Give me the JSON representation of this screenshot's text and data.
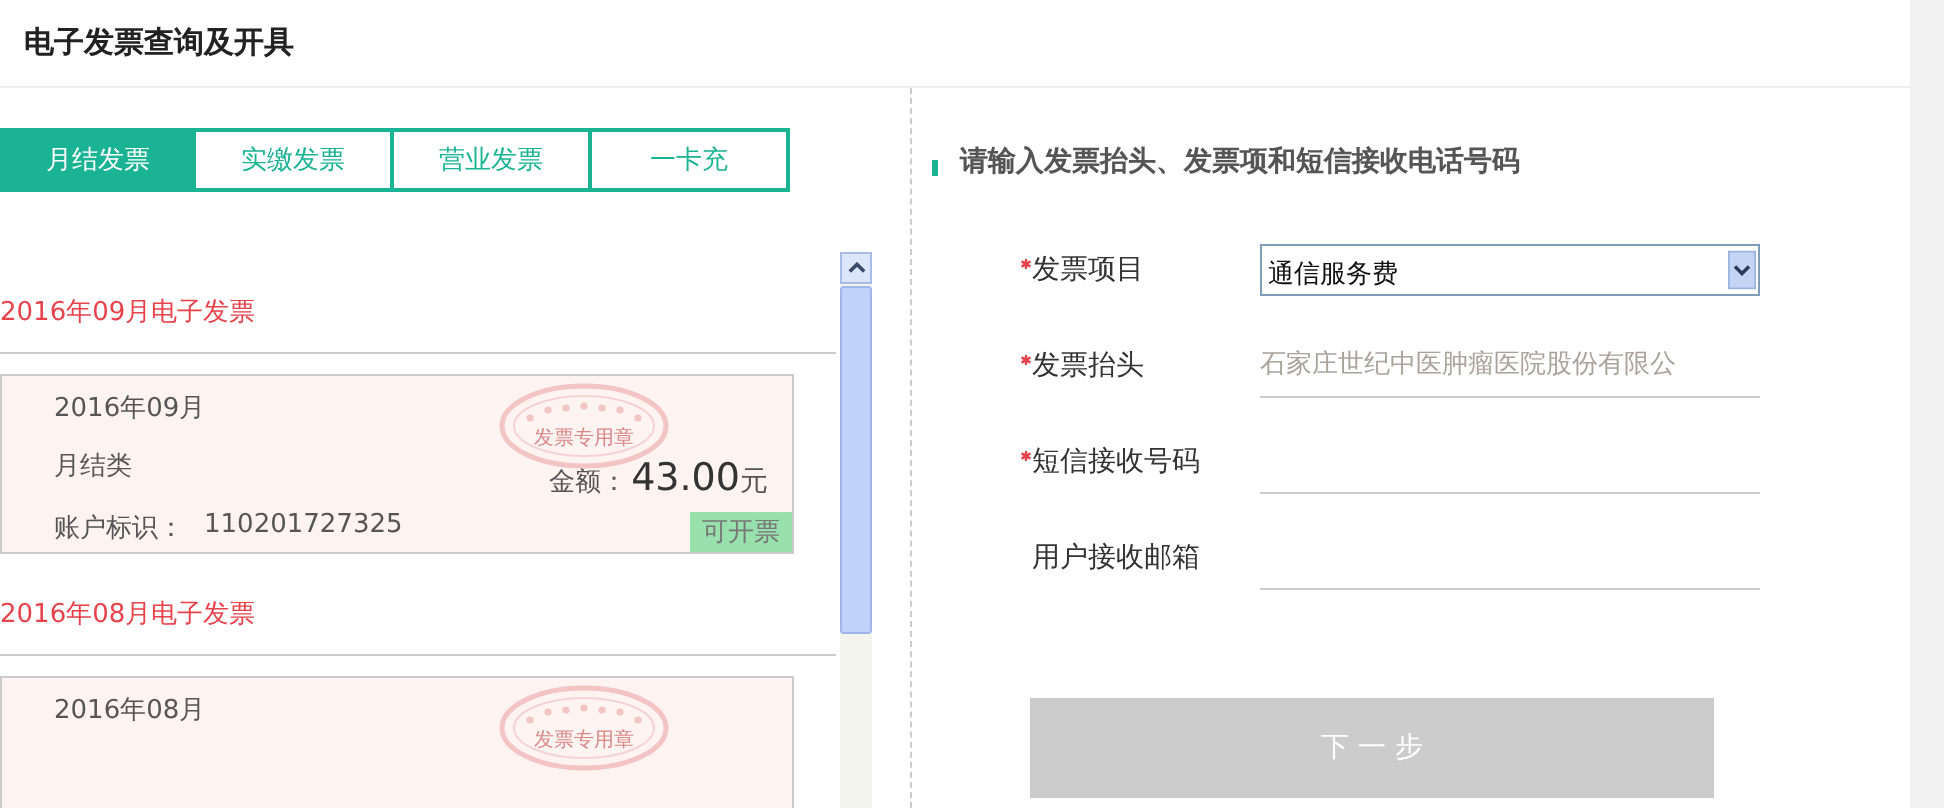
{
  "header": {
    "title": "电子发票查询及开具"
  },
  "tabs": [
    {
      "label": "月结发票",
      "selected": true
    },
    {
      "label": "实缴发票",
      "selected": false
    },
    {
      "label": "营业发票",
      "selected": false
    },
    {
      "label": "一卡充",
      "selected": false
    }
  ],
  "invoice_groups": [
    {
      "heading": "2016年09月电子发票",
      "card": {
        "period": "2016年09月",
        "type": "月结类",
        "account_label": "账户标识：",
        "account": "110201727325",
        "amount_label": "金额：",
        "amount": "43.00",
        "currency": "元",
        "stamp_text": "发票专用章",
        "status": "可开票"
      }
    },
    {
      "heading": "2016年08月电子发票",
      "card": {
        "period": "2016年08月",
        "stamp_text": "发票专用章"
      }
    }
  ],
  "form": {
    "heading": "请输入发票抬头、发票项和短信接收电话号码",
    "fields": [
      {
        "label": "发票项目",
        "required": true,
        "kind": "select",
        "value": "通信服务费"
      },
      {
        "label": "发票抬头",
        "required": true,
        "kind": "text",
        "placeholder": "石家庄世纪中医肿瘤医院股份有限公"
      },
      {
        "label": "短信接收号码",
        "required": true,
        "kind": "text"
      },
      {
        "label": "用户接收邮箱",
        "required": false,
        "kind": "text"
      }
    ],
    "submit": "下 一 步"
  }
}
